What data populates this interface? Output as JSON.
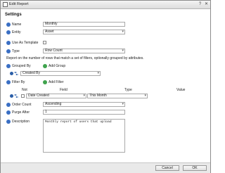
{
  "window": {
    "title": "Edit Report",
    "close_glyph": "✕",
    "help_glyph": "?"
  },
  "form": {
    "heading": "Settings",
    "name": {
      "label": "Name",
      "value": "Monthly"
    },
    "entity": {
      "label": "Entity",
      "value": "Asset"
    },
    "use_as_template": {
      "label": "Use As Template"
    },
    "type": {
      "label": "Type",
      "value": "Row Count"
    },
    "type_description": "Report on the number of rows that match a set of filters, optionally grouped by attributes.",
    "grouped_by": {
      "label": "Grouped By",
      "add_label": "Add Group",
      "group_value": "Created By"
    },
    "filter_by": {
      "label": "Filter By",
      "add_label": "Add Filter",
      "columns": [
        "Not",
        "Field",
        "Type",
        "Value"
      ],
      "row": {
        "field": "Date Created",
        "type": "This Month"
      }
    },
    "order_count": {
      "label": "Order Count",
      "value": "Ascending"
    },
    "purge_after": {
      "label": "Purge After",
      "value": "1"
    },
    "description": {
      "label": "Description",
      "value": "Monthly report of users that upload"
    }
  },
  "footer": {
    "cancel_label": "Cancel",
    "ok_label": "OK"
  },
  "colors": {
    "accent_blue": "#3a6fc4",
    "add_green": "#3fa34d"
  }
}
